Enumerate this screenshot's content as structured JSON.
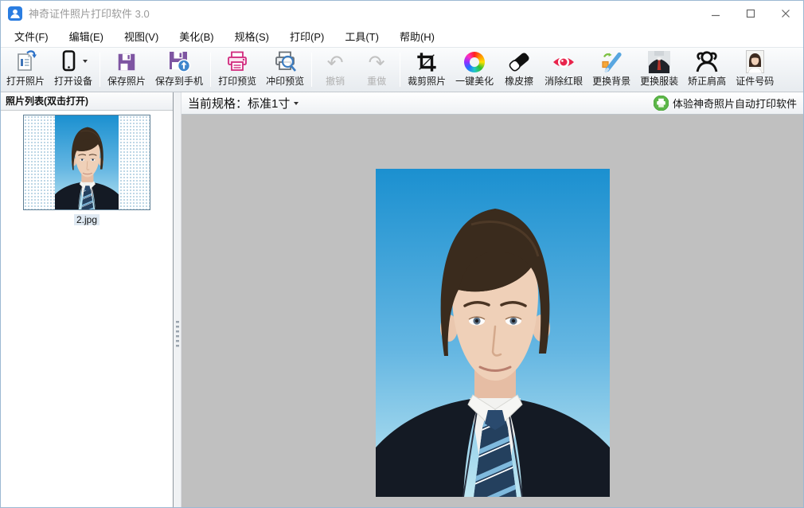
{
  "window": {
    "title": "神奇证件照片打印软件 3.0"
  },
  "menu": {
    "items": [
      "文件(F)",
      "编辑(E)",
      "视图(V)",
      "美化(B)",
      "规格(S)",
      "打印(P)",
      "工具(T)",
      "帮助(H)"
    ]
  },
  "toolbar": {
    "buttons": [
      {
        "label": "打开照片",
        "icon": "open-photo-icon",
        "enabled": true
      },
      {
        "label": "打开设备",
        "icon": "open-device-icon",
        "enabled": true
      },
      {
        "label": "保存照片",
        "icon": "save-photo-icon",
        "enabled": true
      },
      {
        "label": "保存到手机",
        "icon": "save-to-phone-icon",
        "enabled": true
      },
      {
        "label": "打印预览",
        "icon": "print-preview-icon",
        "enabled": true
      },
      {
        "label": "冲印预览",
        "icon": "develop-preview-icon",
        "enabled": true
      },
      {
        "label": "撤销",
        "icon": "undo-icon",
        "glyph": "↶",
        "enabled": false
      },
      {
        "label": "重做",
        "icon": "redo-icon",
        "glyph": "↷",
        "enabled": false
      },
      {
        "label": "裁剪照片",
        "icon": "crop-icon",
        "enabled": true
      },
      {
        "label": "一键美化",
        "icon": "beautify-icon",
        "enabled": true
      },
      {
        "label": "橡皮擦",
        "icon": "eraser-icon",
        "enabled": true
      },
      {
        "label": "消除红眼",
        "icon": "red-eye-icon",
        "enabled": true
      },
      {
        "label": "更换背景",
        "icon": "change-background-icon",
        "enabled": true
      },
      {
        "label": "更换服装",
        "icon": "change-clothes-icon",
        "enabled": true
      },
      {
        "label": "矫正肩高",
        "icon": "fix-shoulder-icon",
        "enabled": true
      },
      {
        "label": "证件号码",
        "icon": "id-number-icon",
        "enabled": true
      }
    ]
  },
  "photo_list": {
    "header": "照片列表(双击打开)",
    "items": [
      {
        "filename": "2.jpg",
        "selected": true
      }
    ]
  },
  "spec_bar": {
    "label": "当前规格：",
    "value": "标准1寸",
    "promo": "体验神奇照片自动打印软件"
  },
  "colors": {
    "canvas_gray": "#c0c0c0",
    "photo_bg_top": "#1b90d0",
    "photo_bg_bottom": "#bfe7f2",
    "save_purple": "#7e55a2",
    "print_magenta": "#d12a7e",
    "promo_green": "#5cb648",
    "red_eye": "#e8244c",
    "title_text": "#9a9a9a"
  }
}
